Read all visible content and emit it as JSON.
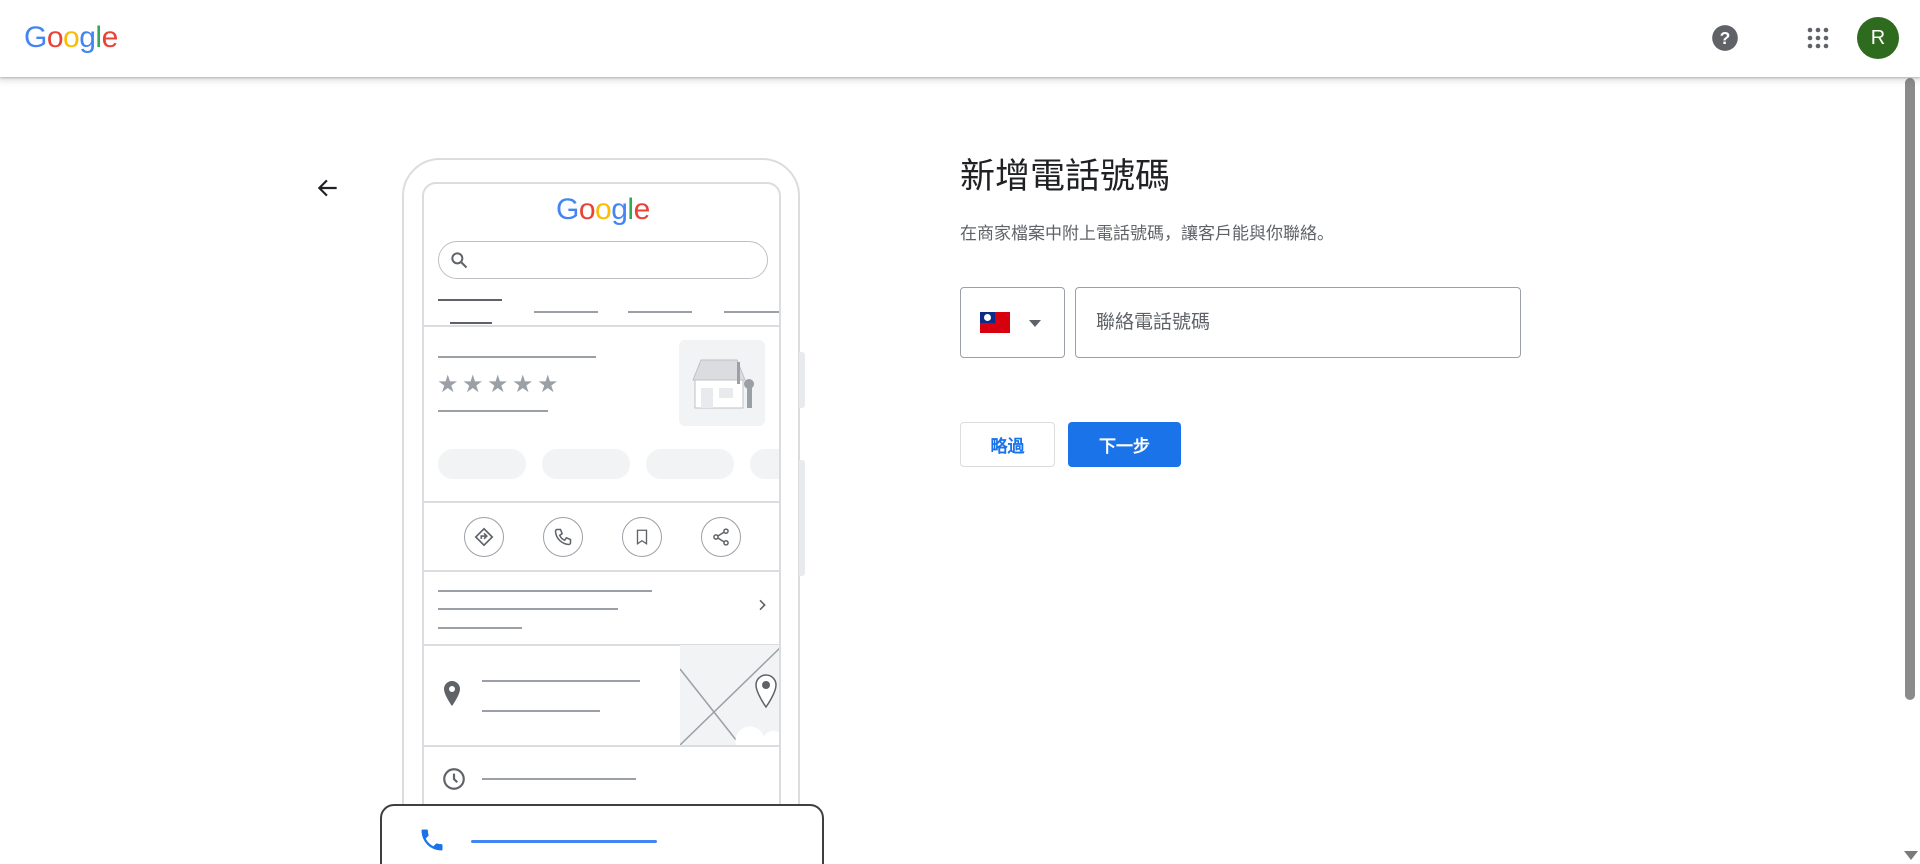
{
  "header": {
    "logo": {
      "g": "G",
      "o1": "o",
      "o2": "o",
      "g2": "g",
      "l": "l",
      "e": "e"
    },
    "help_icon": "help-circle-icon",
    "apps_icon": "apps-grid-icon",
    "avatar_letter": "R",
    "avatar_color": "#2e6b1e"
  },
  "illustration": {
    "logo": {
      "g": "G",
      "o1": "o",
      "o2": "o",
      "g2": "g",
      "l": "l",
      "e": "e"
    },
    "stars": [
      "★",
      "★",
      "★",
      "★",
      "★"
    ],
    "accent_color": "#4285F4"
  },
  "form": {
    "title": "新增電話號碼",
    "subtitle": "在商家檔案中附上電話號碼，讓客戶能與你聯絡。",
    "country_flag": "taiwan-flag-icon",
    "phone_placeholder": "聯絡電話號碼",
    "phone_value": "",
    "skip_label": "略過",
    "next_label": "下一步"
  },
  "colors": {
    "primary": "#1a73e8",
    "text": "#202124",
    "secondary_text": "#5f6368"
  }
}
